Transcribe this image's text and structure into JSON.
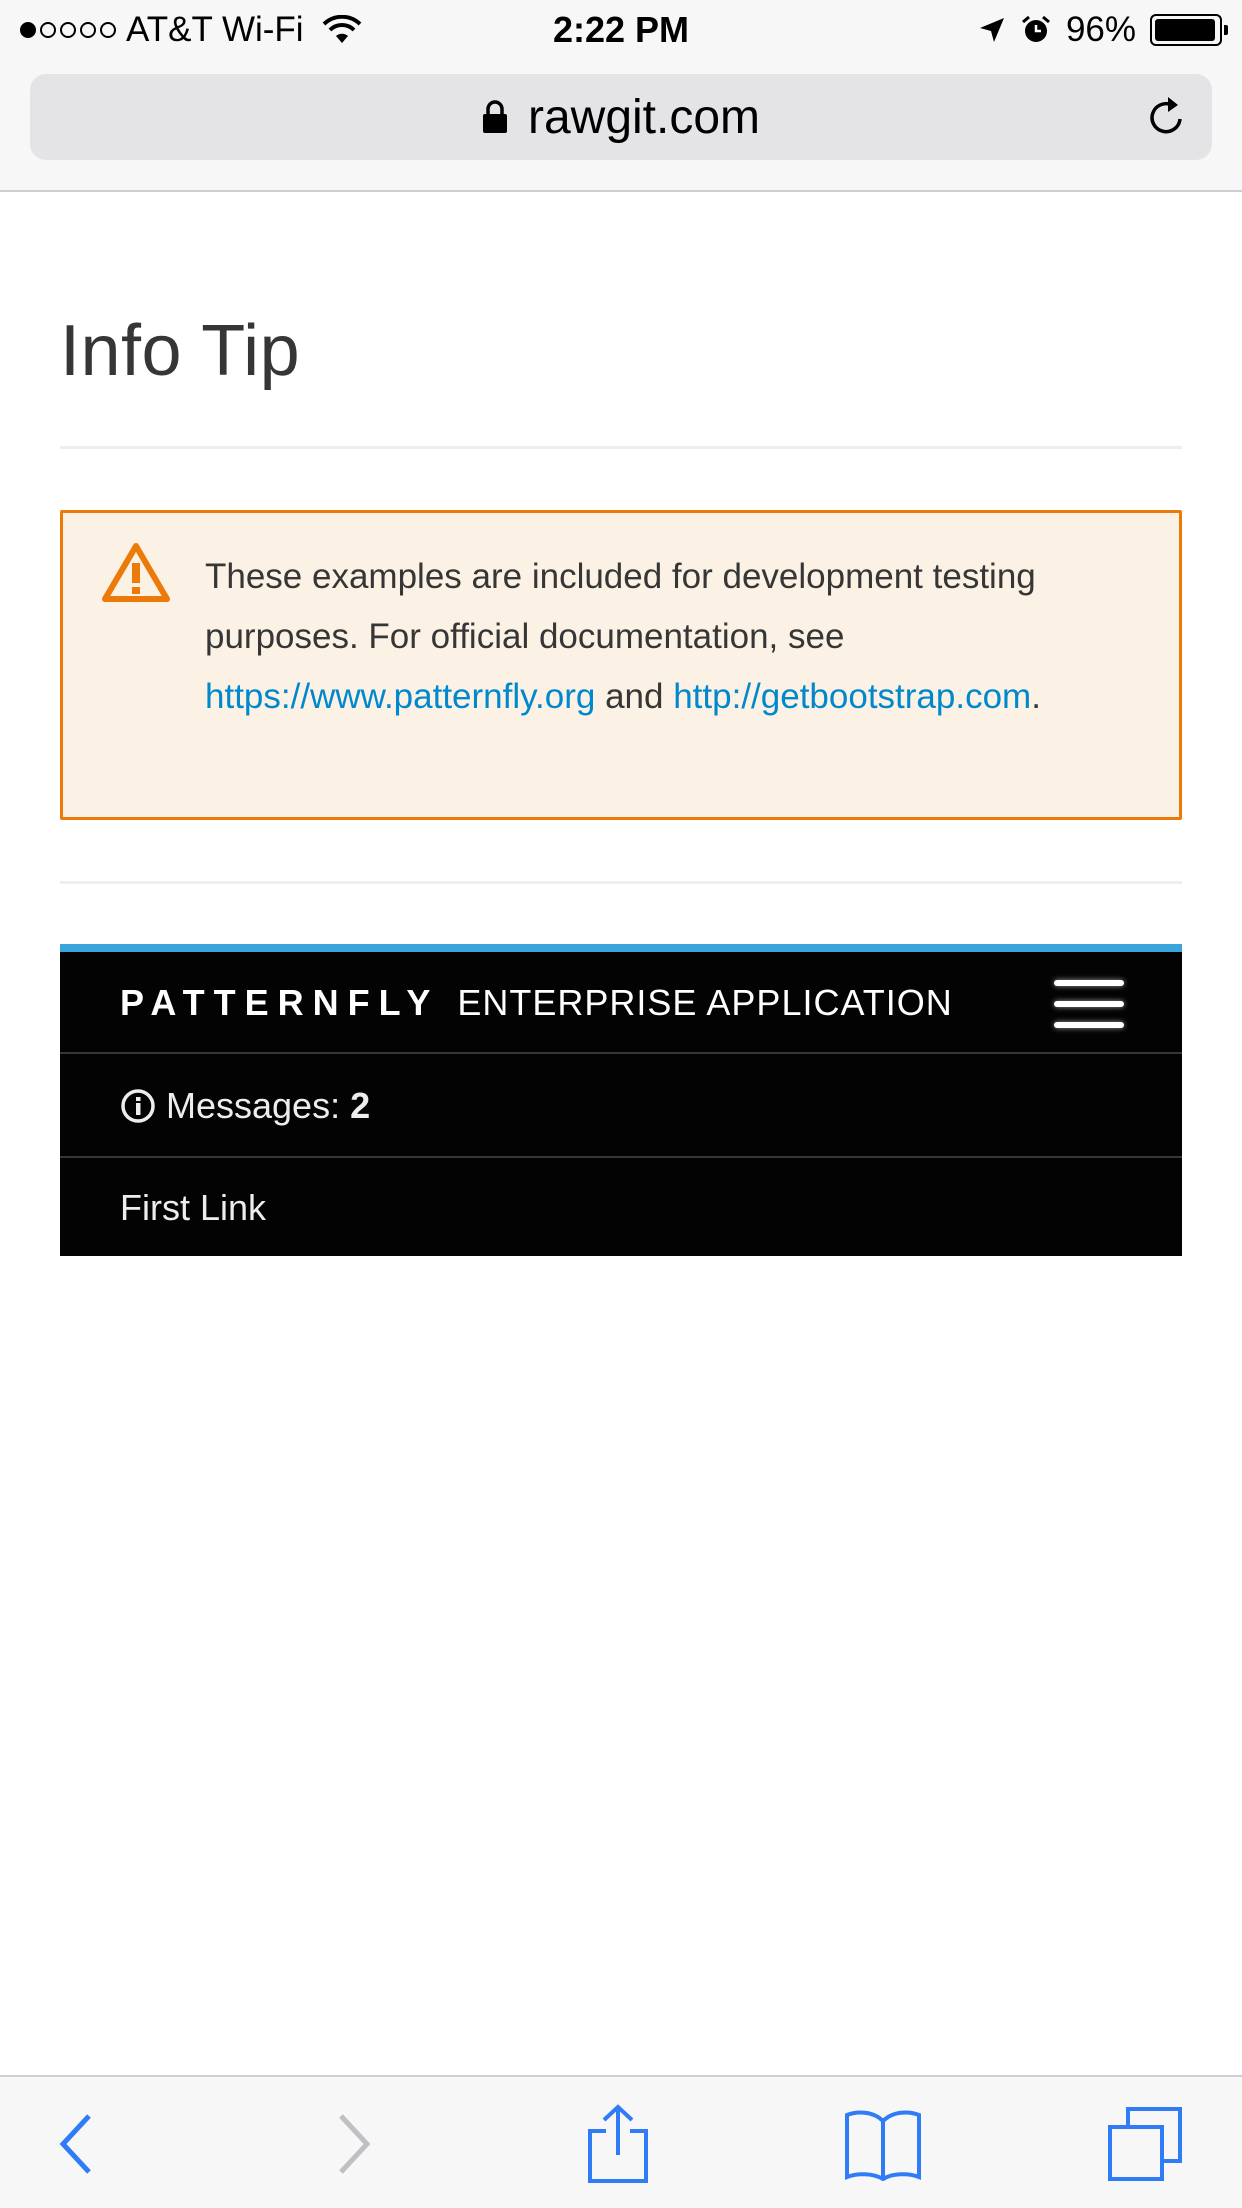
{
  "status_bar": {
    "carrier": "AT&T Wi-Fi",
    "time": "2:22 PM",
    "battery": "96%",
    "battery_level": 0.96
  },
  "browser": {
    "url": "rawgit.com"
  },
  "page": {
    "title": "Info Tip",
    "alert": {
      "text_1": "These examples are included for development testing purposes. For official documentation, see ",
      "link_1": "https://www.patternfly.org",
      "text_2": " and ",
      "link_2": "http://getbootstrap.com",
      "text_3": "."
    },
    "navbar": {
      "brand": "PATTERNFLY",
      "brand_subtitle": "ENTERPRISE APPLICATION",
      "messages_label": "Messages:",
      "messages_count": "2",
      "first_link": "First Link"
    }
  },
  "colors": {
    "accent": "#0088ce",
    "warning": "#ec7a08",
    "navbar_bg": "#030303",
    "navbar_top_border": "#39a5dc",
    "ios_blue": "#2f7cf6"
  },
  "icons": {
    "status": [
      "signal-dots",
      "wifi-icon",
      "location-arrow-icon",
      "alarm-icon",
      "battery-icon"
    ],
    "browser": [
      "lock-icon",
      "reload-icon"
    ],
    "alert": "warning-triangle-icon",
    "navbar": [
      "hamburger-icon",
      "info-circle-icon"
    ],
    "toolbar": [
      "back-icon",
      "forward-icon",
      "share-icon",
      "bookmarks-icon",
      "tabs-icon"
    ]
  }
}
